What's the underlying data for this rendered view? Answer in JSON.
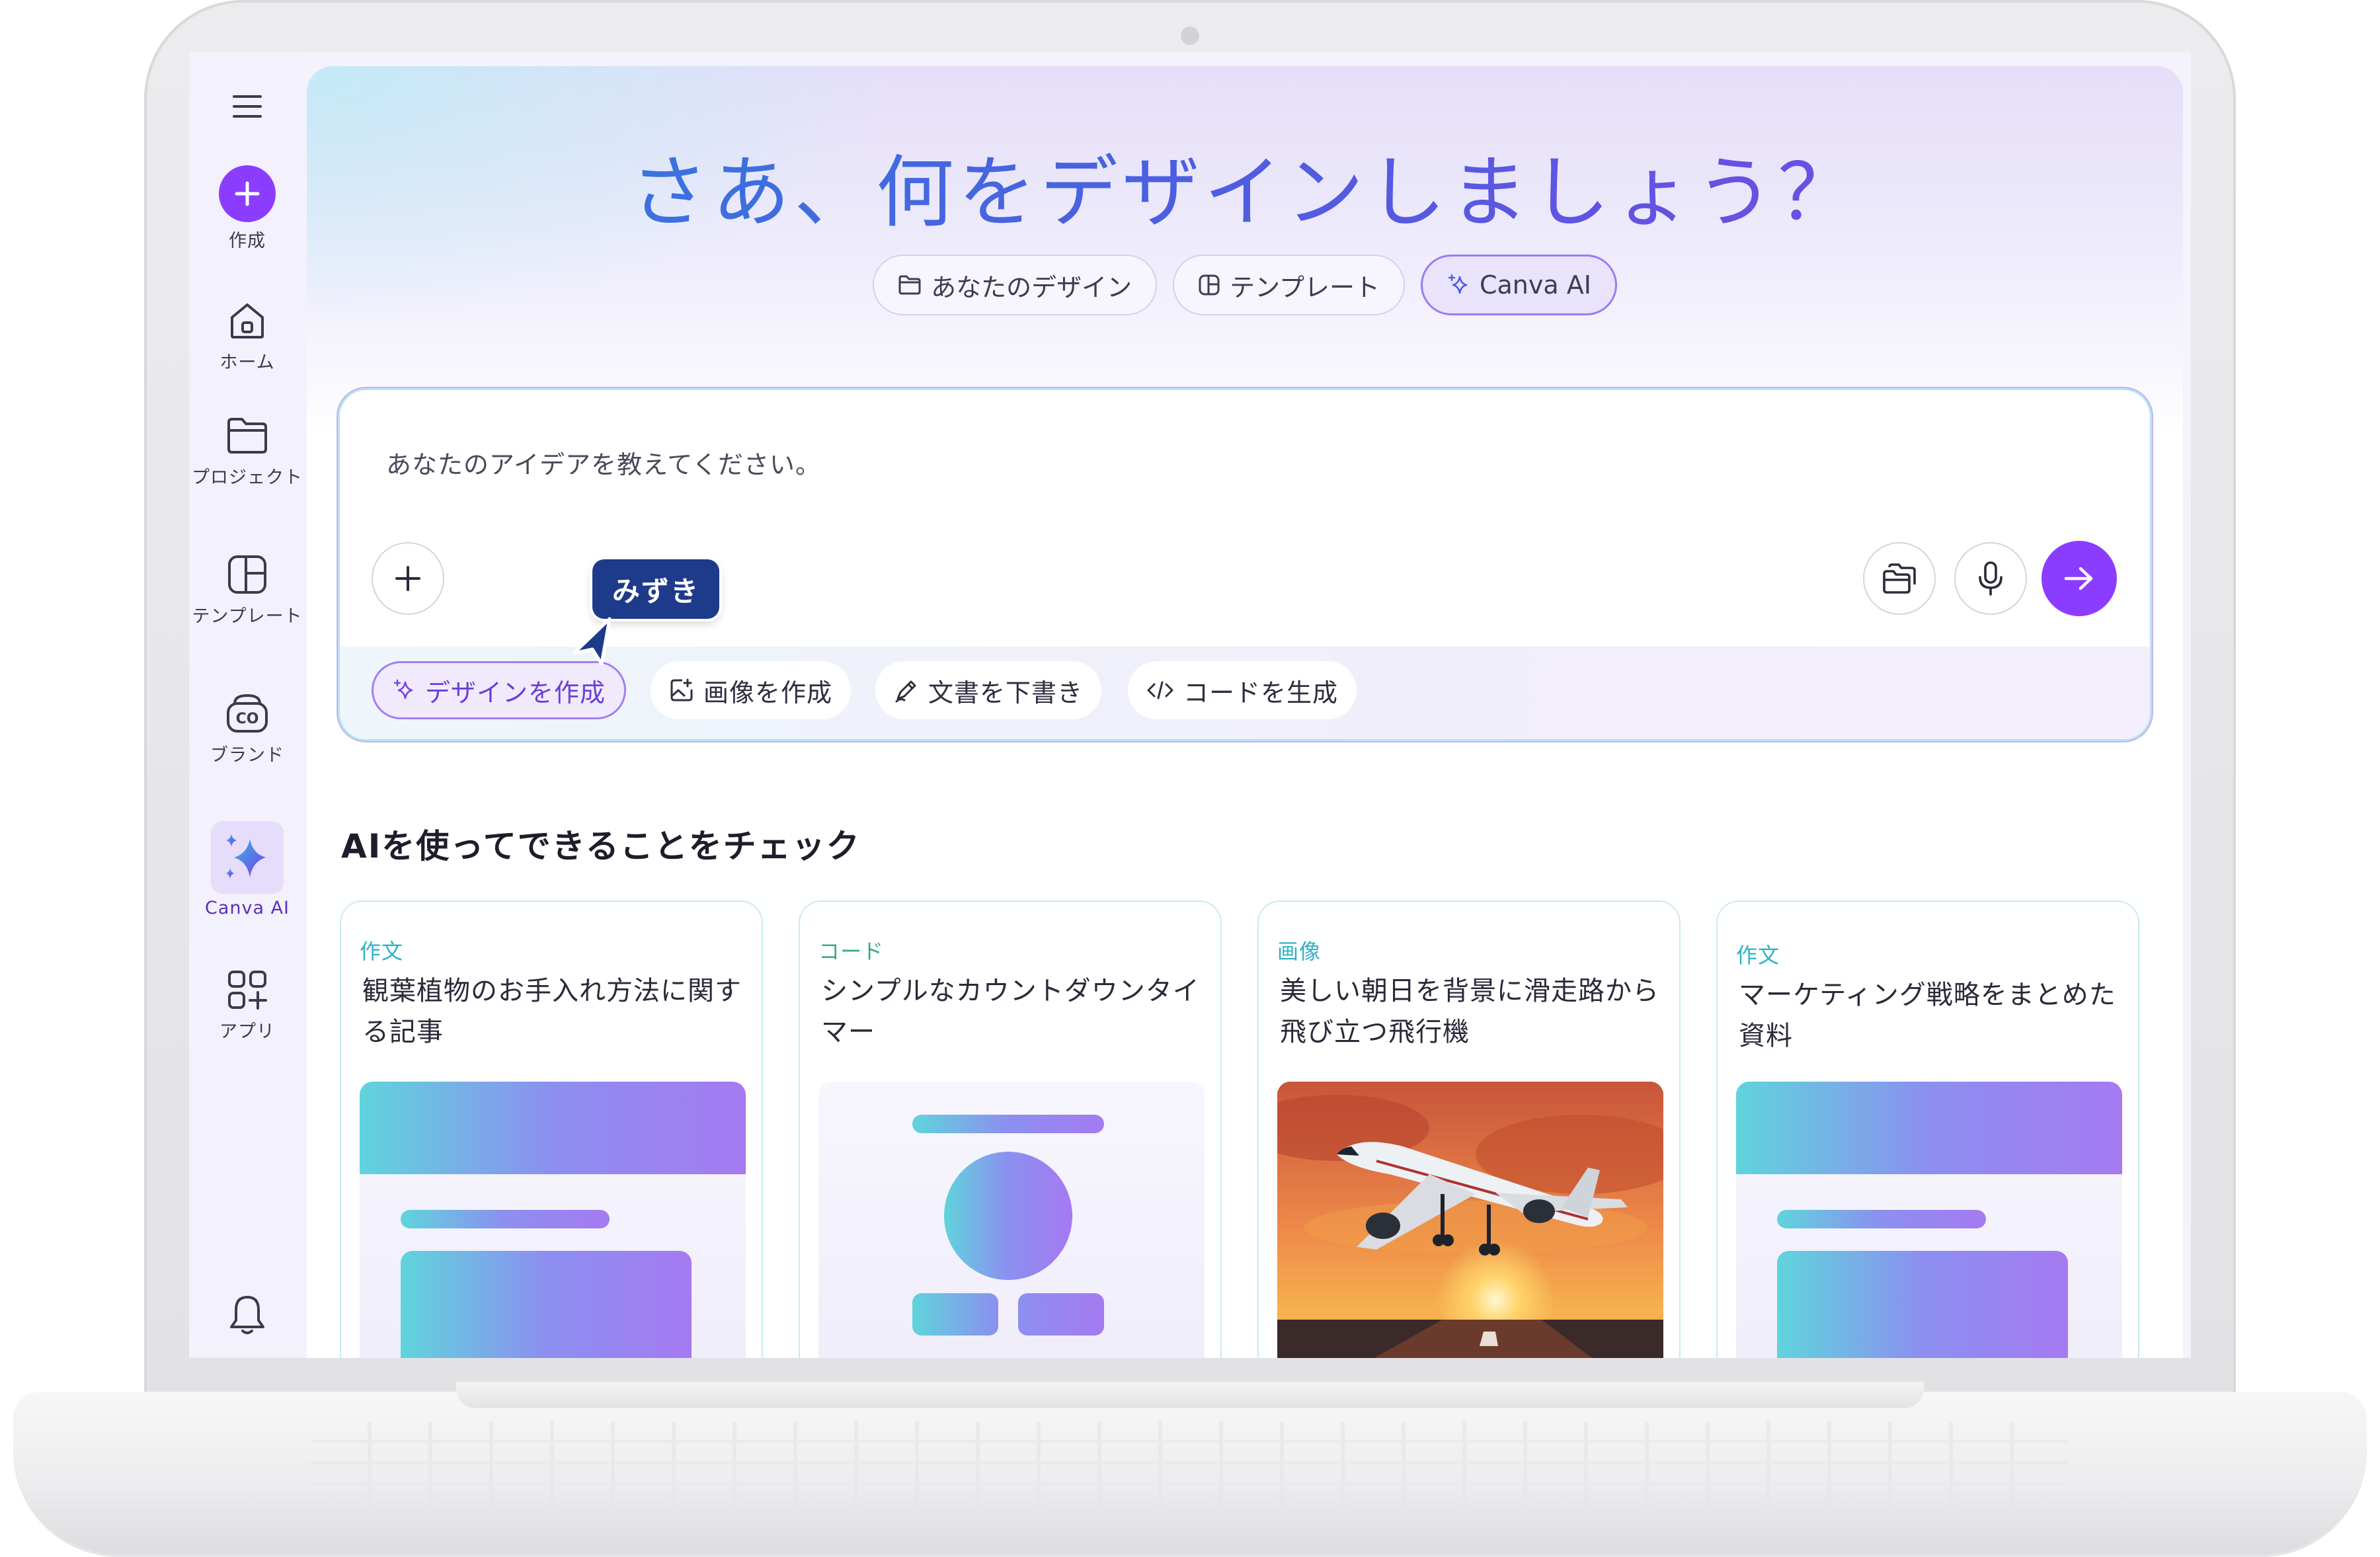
{
  "sidebar": {
    "items": [
      {
        "label": "作成",
        "icon": "plus-icon"
      },
      {
        "label": "ホーム",
        "icon": "home-icon"
      },
      {
        "label": "プロジェクト",
        "icon": "folder-icon"
      },
      {
        "label": "テンプレート",
        "icon": "template-icon"
      },
      {
        "label": "ブランド",
        "icon": "brand-icon"
      },
      {
        "label": "Canva AI",
        "icon": "sparkle-icon"
      },
      {
        "label": "アプリ",
        "icon": "apps-icon"
      }
    ]
  },
  "hero": {
    "title": "さあ、何をデザインしましょう？",
    "tabs": [
      {
        "label": "あなたのデザイン",
        "icon": "folder-icon"
      },
      {
        "label": "テンプレート",
        "icon": "template-icon"
      },
      {
        "label": "Canva AI",
        "icon": "sparkle-icon"
      }
    ]
  },
  "prompt": {
    "placeholder": "あなたのアイデアを教えてください。",
    "chips": [
      {
        "label": "デザインを作成",
        "icon": "sparkle-icon"
      },
      {
        "label": "画像を作成",
        "icon": "image-edit-icon"
      },
      {
        "label": "文書を下書き",
        "icon": "pen-icon"
      },
      {
        "label": "コードを生成",
        "icon": "code-icon"
      }
    ]
  },
  "tooltip": {
    "label": "みずき"
  },
  "section": {
    "title": "AIを使ってできることをチェック",
    "cards": [
      {
        "category": "作文",
        "title": "観葉植物のお手入れ方法に関する記事"
      },
      {
        "category": "コード",
        "title": "シンプルなカウントダウンタイマー"
      },
      {
        "category": "画像",
        "title": "美しい朝日を背景に滑走路から飛び立つ飛行機"
      },
      {
        "category": "作文",
        "title": "マーケティング戦略をまとめた資料"
      }
    ]
  },
  "colors": {
    "accent": "#8b3dff",
    "tooltip": "#1e3a8a",
    "category": "#2fb2c9"
  }
}
